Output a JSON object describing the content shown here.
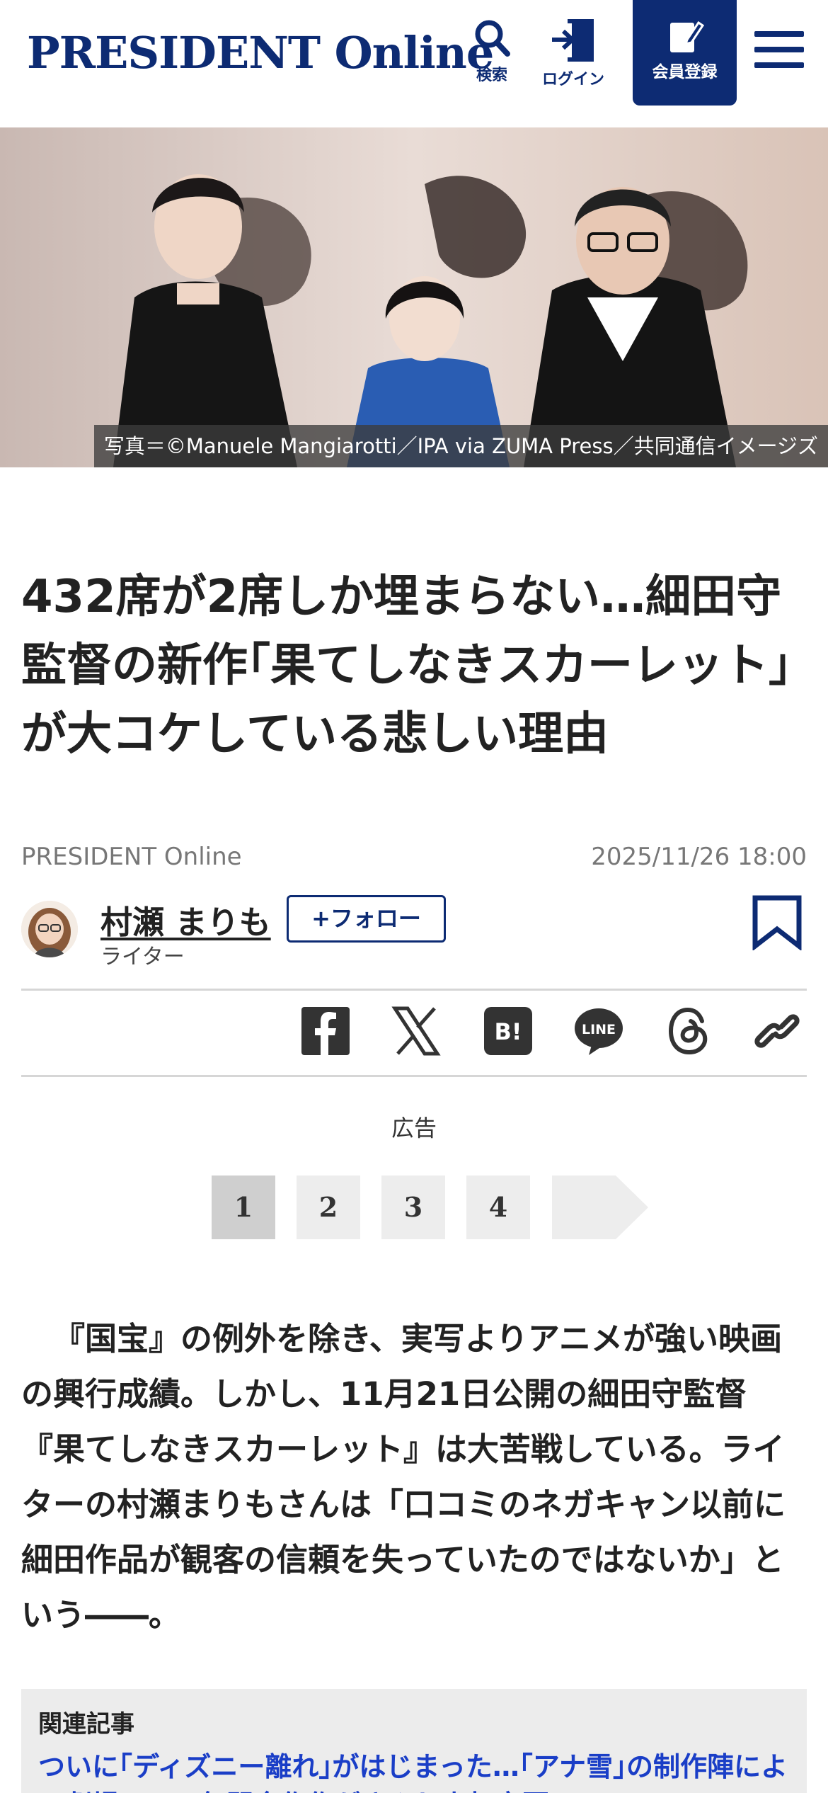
{
  "header": {
    "logo": "PRESIDENT Online",
    "search_label": "検索",
    "login_label": "ログイン",
    "register_label": "会員登録"
  },
  "hero": {
    "caption": "写真＝©Manuele Mangiarotti／IPA via ZUMA Press／共同通信イメージズ"
  },
  "article": {
    "title": "432席が2席しか埋まらない…細田守監督の新作｢果てしなきスカーレット｣が大コケしている悲しい理由",
    "source": "PRESIDENT Online",
    "date": "2025/11/26 18:00",
    "author_name": "村瀬 まりも",
    "author_role": "ライター",
    "follow_label": "+フォロー",
    "ad_label": "広告",
    "lead": "『国宝』の例外を除き、実写よりアニメが強い映画の興行成績。しかし、11月21日公開の細田守監督『果てしなきスカーレット』は大苦戦している。ライターの村瀬まりもさんは「口コミのネガキャン以前に細田作品が観客の信頼を失っていたのではないか」という――。"
  },
  "share": {
    "hatena_label": "B!",
    "line_label": "LINE"
  },
  "pagination": {
    "pages": [
      "1",
      "2",
      "3",
      "4"
    ],
    "current": 1
  },
  "related": {
    "heading": "関連記事",
    "link_text": "ついに｢ディズニー離れ｣がはじまった…｢アナ雪｣の制作陣による劇場ーー五年間全作作がさんし上打京悪"
  },
  "colors": {
    "brand": "#0d2b73",
    "link": "#1a3ec7"
  }
}
